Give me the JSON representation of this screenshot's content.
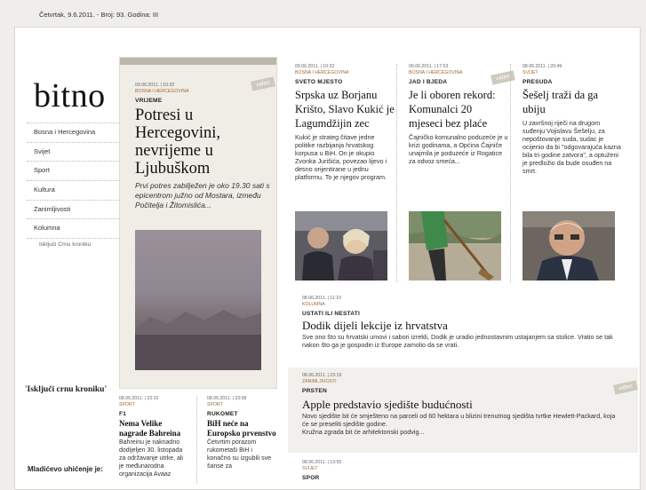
{
  "topbar": {
    "text": "Četvrtak, 9.6.2011. - Broj: 93. Godina: III"
  },
  "logo": "bitno",
  "nav": {
    "items": [
      "Bosna i Hercegovina",
      "Svijet",
      "Sport",
      "Kultura",
      "Zanimljivosti",
      "Kolumna"
    ],
    "toggle": "Isključi Crnu kroniku"
  },
  "sidebar": {
    "crna_title": "'Isključi crnu kroniku'",
    "mladic": "Mladićevo uhićenje je:"
  },
  "video_label": "video",
  "feature": {
    "meta": "09.06.2011. | 10:20",
    "category": "BOSNA I HERCEGOVINA",
    "kicker": "VRIJEME",
    "headline": "Potresi u Hercegovini, nevrijeme u Ljubuškom",
    "lead": "Prvi potres zabilježen je oko 19.30 sati s epicentrom južno od Mostara, između Počitelja i Žitomislića..."
  },
  "articles": [
    {
      "meta": "09.06.2011. | 10:32",
      "category": "BOSNA I HERCEGOVINA",
      "kicker": "SVETO MJESTO",
      "headline": "Srpska uz Borjanu Krišto, Slavo Kukić je Lagumdžijin zec",
      "body": "Kukić je strateg čitave jedne politike razbijanja hrvatskog korpusa u BiH. On je okupio Zvonka Jurišića, povezao lijevo i desno orijentirane u jednu platformu. To je njegov program."
    },
    {
      "meta": "09.06.2011. | 17:53",
      "category": "BOSNA I HERCEGOVINA",
      "kicker": "JAD I BJEDA",
      "headline": "Je li oboren rekord: Komunalci 20 mjeseci bez plaće",
      "body": "Čajničko komunalno poduzeće je u krizi godinama, a Općina Čajniče unajmila je poduzeće iz Rogatice za odvoz smeća..."
    },
    {
      "meta": "08.06.2011. | 20:49",
      "category": "SVIJET",
      "kicker": "PRESUDA",
      "headline": "Šešelj traži da ga ubiju",
      "body": "U završnoj riječi na drugom suđenju Vojislavu Šešelju, za nepoštovanje suda, sudac je ocijenio da bi \"odgovarajuća kazna bila tri godine zatvora\", a optuženi je predložio da bude osuđen na smrt."
    }
  ],
  "dodik": {
    "meta": "08.06.2011. | 11:10",
    "category": "KOLUMNA",
    "kicker": "USTATI ILI NESTATI",
    "headline": "Dodik dijeli lekcije iz hrvatstva",
    "body": "Sve ono što su hrvatski umovi i sabori izrekli, Dodik je uradio jednostavnim ustajanjem sa stolice. Vratio se tak nakon što ga je gospodin iz Europe zamolio da se vrati."
  },
  "apple": {
    "meta": "08.06.2011. | 23:19",
    "category": "ZANIMLJIVOSTI",
    "kicker": "PRSTEN",
    "headline": "Apple predstavio sjedište budućnosti",
    "body1": "Novo sjedište bit će smješteno na parceli od 60 hektara u blizini trenutnog sjedišta tvrtke Hewlett-Packard, koja će se preseliti sjedište godine.",
    "body2": "Kružna zgrada bit će arhitektonski podvig..."
  },
  "spor": {
    "meta": "08.06.2011. | 13:55",
    "category": "SVIJET",
    "kicker": "SPOR"
  },
  "small": [
    {
      "meta": "08.06.2011. | 23:10",
      "category": "SPORT",
      "kicker": "F1",
      "headline": "Nema Velike nagrade Bahreina",
      "body": "Bahreinu je naknadno dodijeljen 30. listopada za održavanje utrke, ali je međunarodna organizacija Avaaz"
    },
    {
      "meta": "08.06.2011. | 23:08",
      "category": "SPORT",
      "kicker": "RUKOMET",
      "headline": "BiH neće na Europsko prvenstvo",
      "body": "Četvrtim porazom rukometaši BiH i konačno su izgubili sve šanse za"
    }
  ]
}
